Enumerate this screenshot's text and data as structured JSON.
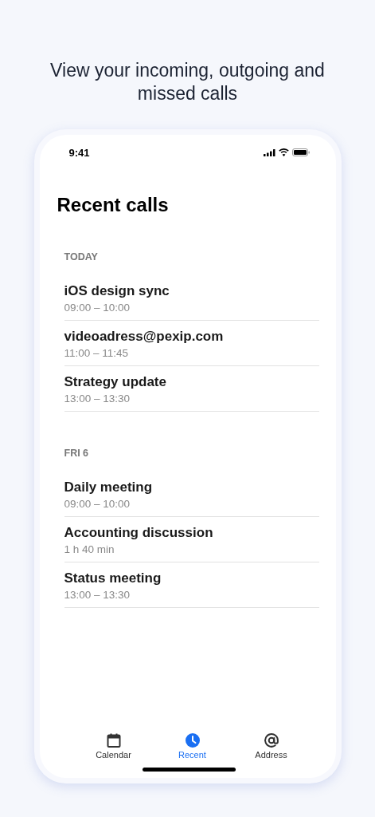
{
  "headline": "View your incoming, outgoing and missed calls",
  "status_bar": {
    "time": "9:41"
  },
  "title": "Recent calls",
  "sections": [
    {
      "heading": "TODAY",
      "calls": [
        {
          "name": "iOS design sync",
          "time": "09:00 – 10:00"
        },
        {
          "name": "videoadress@pexip.com",
          "time": "11:00 – 11:45"
        },
        {
          "name": "Strategy update",
          "time": "13:00 – 13:30"
        }
      ]
    },
    {
      "heading": "FRI 6",
      "calls": [
        {
          "name": "Daily meeting",
          "time": "09:00 – 10:00"
        },
        {
          "name": "Accounting discussion",
          "time": "1 h 40 min"
        },
        {
          "name": "Status meeting",
          "time": "13:00 – 13:30"
        }
      ]
    }
  ],
  "tabs": [
    {
      "label": "Calendar",
      "kind": "calendar",
      "selected": false
    },
    {
      "label": "Recent",
      "kind": "clock",
      "selected": true
    },
    {
      "label": "Address",
      "kind": "at",
      "selected": false
    }
  ]
}
